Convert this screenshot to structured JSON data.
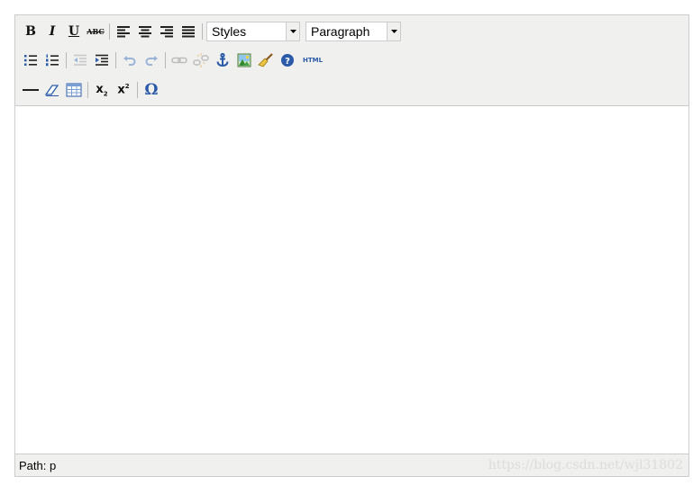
{
  "toolbar": {
    "styles_select": {
      "value": "Styles"
    },
    "format_select": {
      "value": "Paragraph"
    },
    "html_button_label": "HTML",
    "omega_label": "Ω"
  },
  "statusbar": {
    "path_label": "Path:",
    "path_value": "p",
    "watermark": "https://blog.csdn.net/wjl31802"
  },
  "icons": {
    "bold": "bold-icon",
    "italic": "italic-icon",
    "underline": "underline-icon",
    "strikethrough": "strikethrough-icon",
    "align_left": "align-left-icon",
    "align_center": "align-center-icon",
    "align_right": "align-right-icon",
    "align_justify": "align-justify-icon",
    "bullet_list": "bullet-list-icon",
    "numbered_list": "numbered-list-icon",
    "outdent": "outdent-icon",
    "indent": "indent-icon",
    "undo": "undo-icon",
    "redo": "redo-icon",
    "link": "link-icon",
    "unlink": "unlink-icon",
    "anchor": "anchor-icon",
    "image": "image-icon",
    "cleanup": "cleanup-icon",
    "help": "help-icon",
    "hr": "horizontal-rule-icon",
    "remove_format": "remove-format-icon",
    "table": "table-icon",
    "subscript": "subscript-icon",
    "superscript": "superscript-icon",
    "special_char": "special-char-icon"
  },
  "colors": {
    "toolbar_bg": "#f0f0ee",
    "border": "#cccccc",
    "accent_blue": "#2a5aa8"
  }
}
